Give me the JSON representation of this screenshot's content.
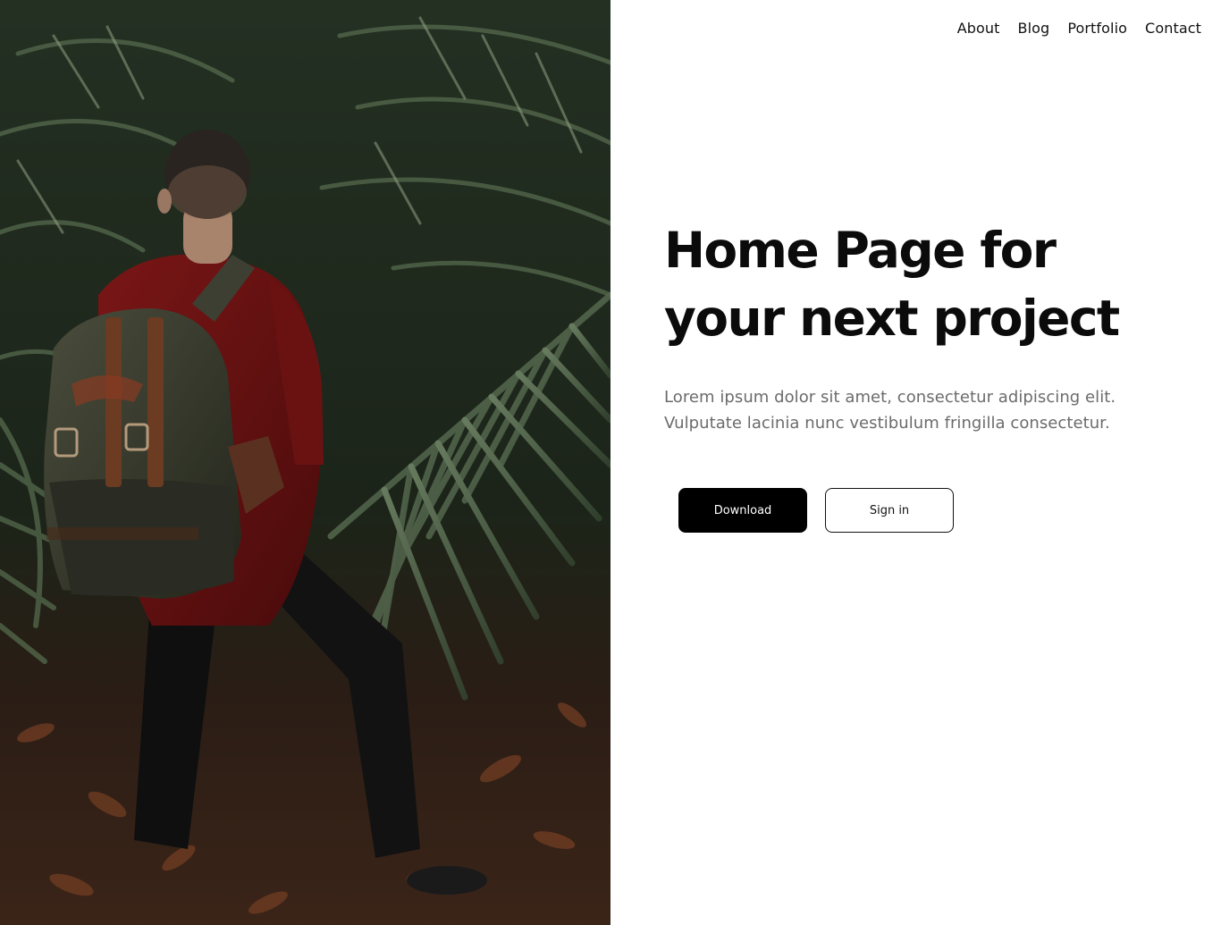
{
  "nav": {
    "items": [
      {
        "label": "About"
      },
      {
        "label": "Blog"
      },
      {
        "label": "Portfolio"
      },
      {
        "label": "Contact"
      }
    ]
  },
  "hero": {
    "image_subject": "hiker-with-backpack-in-jungle",
    "headline": "Home Page for your next project",
    "lead": "Lorem ipsum dolor sit amet, consectetur adipiscing elit. Vulputate lacinia nunc vestibulum fringilla consectetur.",
    "primary_button": "Download",
    "secondary_button": "Sign in"
  },
  "colors": {
    "text": "#0b0b0b",
    "muted_text": "#6b6b6b",
    "primary_button_bg": "#000000",
    "background": "#ffffff"
  }
}
